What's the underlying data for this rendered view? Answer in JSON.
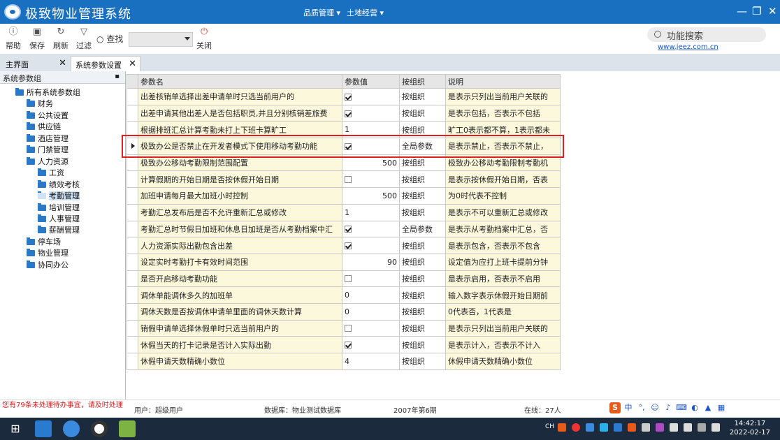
{
  "window": {
    "title": "极致物业管理系统",
    "menus": [
      "品质管理",
      "土地经营"
    ]
  },
  "toolbar": {
    "help": "帮助",
    "save": "保存",
    "refresh": "刷新",
    "filter": "过滤",
    "find": "查找",
    "close": "关闭",
    "search_placeholder": "功能搜索",
    "link": "www.jeez.com.cn"
  },
  "tabs": [
    {
      "label": "主界面"
    },
    {
      "label": "系统参数设置"
    }
  ],
  "sidebar": {
    "title": "系统参数组",
    "root": "所有系统参数组",
    "items": [
      "财务",
      "公共设置",
      "供应链",
      "酒店管理",
      "门禁管理",
      "人力资源",
      "工资",
      "绩效考核",
      "考勤管理",
      "培训管理",
      "人事管理",
      "薪酬管理",
      "停车场",
      "物业管理",
      "协同办公"
    ],
    "selected": "考勤管理"
  },
  "grid": {
    "columns": [
      "参数名",
      "参数值",
      "按组织",
      "说明"
    ],
    "rows": [
      {
        "name": "出差核销单选择出差申请单时只选当前用户的",
        "value": "",
        "checked": true,
        "scope": "按组织",
        "desc": "是表示只列出当前用户关联的"
      },
      {
        "name": "出差申请其他出差人是否包括职员,并且分别核销差旅费",
        "value": "",
        "checked": true,
        "scope": "按组织",
        "desc": "是表示包括，否表示不包括"
      },
      {
        "name": "根据排班汇总计算考勤未打上下班卡算旷工",
        "value": "1",
        "checked": null,
        "scope": "按组织",
        "desc": "旷工0表示都不算，1表示都未"
      },
      {
        "name": "极致办公是否禁止在开发者模式下使用移动考勤功能",
        "value": "",
        "checked": true,
        "scope": "全局参数",
        "desc": "是表示禁止，否表示不禁止，"
      },
      {
        "name": "极致办公移动考勤限制范围配置",
        "value": "500",
        "checked": null,
        "scope": "按组织",
        "desc": "极致办公移动考勤限制考勤机"
      },
      {
        "name": "计算假期的开始日期是否按休假开始日期",
        "value": "",
        "checked": false,
        "scope": "按组织",
        "desc": "是表示按休假开始日期，否表"
      },
      {
        "name": "加班申请每月最大加班小时控制",
        "value": "500",
        "checked": null,
        "scope": "按组织",
        "desc": "为0时代表不控制"
      },
      {
        "name": "考勤汇总发布后是否不允许重新汇总或修改",
        "value": "1",
        "checked": null,
        "scope": "按组织",
        "desc": "是表示不可以重新汇总或修改"
      },
      {
        "name": "考勤汇总时节假日加班和休息日加班是否从考勤档案中汇",
        "value": "",
        "checked": true,
        "scope": "全局参数",
        "desc": "是表示从考勤档案中汇总，否"
      },
      {
        "name": "人力资源实际出勤包含出差",
        "value": "",
        "checked": true,
        "scope": "按组织",
        "desc": "是表示包含，否表示不包含"
      },
      {
        "name": "设定实时考勤打卡有效时间范围",
        "value": "90",
        "checked": null,
        "scope": "按组织",
        "desc": "设定值为应打上班卡提前分钟"
      },
      {
        "name": "是否开启移动考勤功能",
        "value": "",
        "checked": false,
        "scope": "按组织",
        "desc": "是表示启用，否表示不启用"
      },
      {
        "name": "调休单能调休多久的加班单",
        "value": "0",
        "checked": null,
        "scope": "按组织",
        "desc": "输入数字表示休假开始日期前"
      },
      {
        "name": "调休天数是否按调休申请单里面的调休天数计算",
        "value": "0",
        "checked": null,
        "scope": "按组织",
        "desc": "0代表否，1代表是"
      },
      {
        "name": "销假申请单选择休假单时只选当前用户的",
        "value": "",
        "checked": false,
        "scope": "按组织",
        "desc": "是表示只列出当前用户关联的"
      },
      {
        "name": "休假当天的打卡记录是否计入实际出勤",
        "value": "",
        "checked": true,
        "scope": "按组织",
        "desc": "是表示计入，否表示不计入"
      },
      {
        "name": "休假申请天数精确小数位",
        "value": "4",
        "checked": null,
        "scope": "按组织",
        "desc": "休假申请天数精确小数位"
      }
    ],
    "current_row": 3
  },
  "status": {
    "warning": "您有79条未处理待办事宜，请及时处理",
    "user": "用户：超级用户",
    "database": "数据库：物业测试数据库",
    "period": "2007年第6期",
    "online": "在线：27人"
  },
  "clock": {
    "time": "14:42:17",
    "date": "2022-02-17"
  },
  "colors": {
    "title_blue": "#1a70c0",
    "highlight_red": "#e02020",
    "cell_yellow": "#fcf8dc"
  }
}
